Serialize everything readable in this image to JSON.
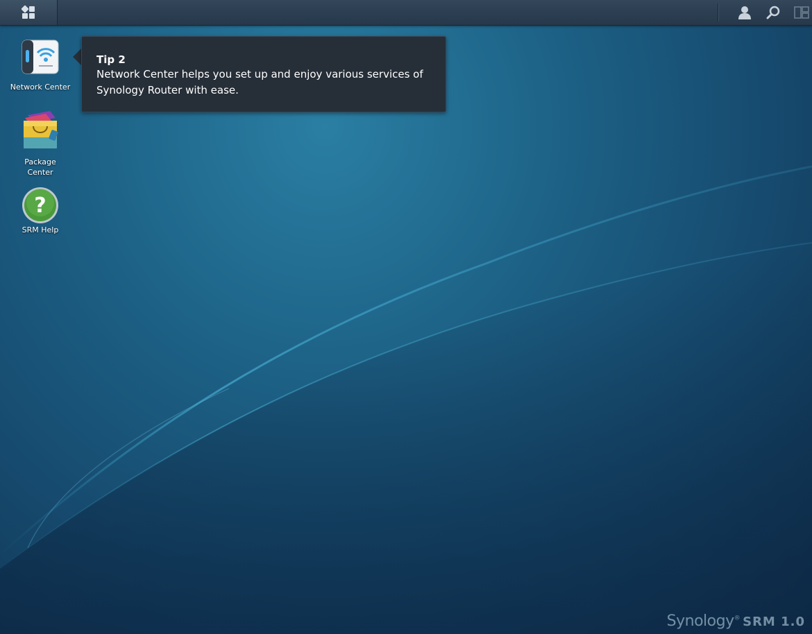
{
  "taskbar": {
    "main_menu_icon": "grid-icon",
    "user_icon": "user-icon",
    "search_icon": "search-icon",
    "widgets_icon": "widgets-icon"
  },
  "desktop": {
    "icons": [
      {
        "label": "Network Center",
        "icon": "network-center-icon"
      },
      {
        "label": "Package Center",
        "icon": "package-center-icon"
      },
      {
        "label": "SRM Help",
        "icon": "help-icon"
      }
    ]
  },
  "tip": {
    "title": "Tip 2",
    "text": "Network Center helps you set up and enjoy various services of Synology Router with ease."
  },
  "brand": {
    "name": "Synology",
    "trademark": "®",
    "product": "SRM 1.0"
  },
  "colors": {
    "desktop_bg": "#1d6186",
    "taskbar": "#2c3e51",
    "tip_bg": "#262e38",
    "help_green": "#4a9a3a"
  }
}
